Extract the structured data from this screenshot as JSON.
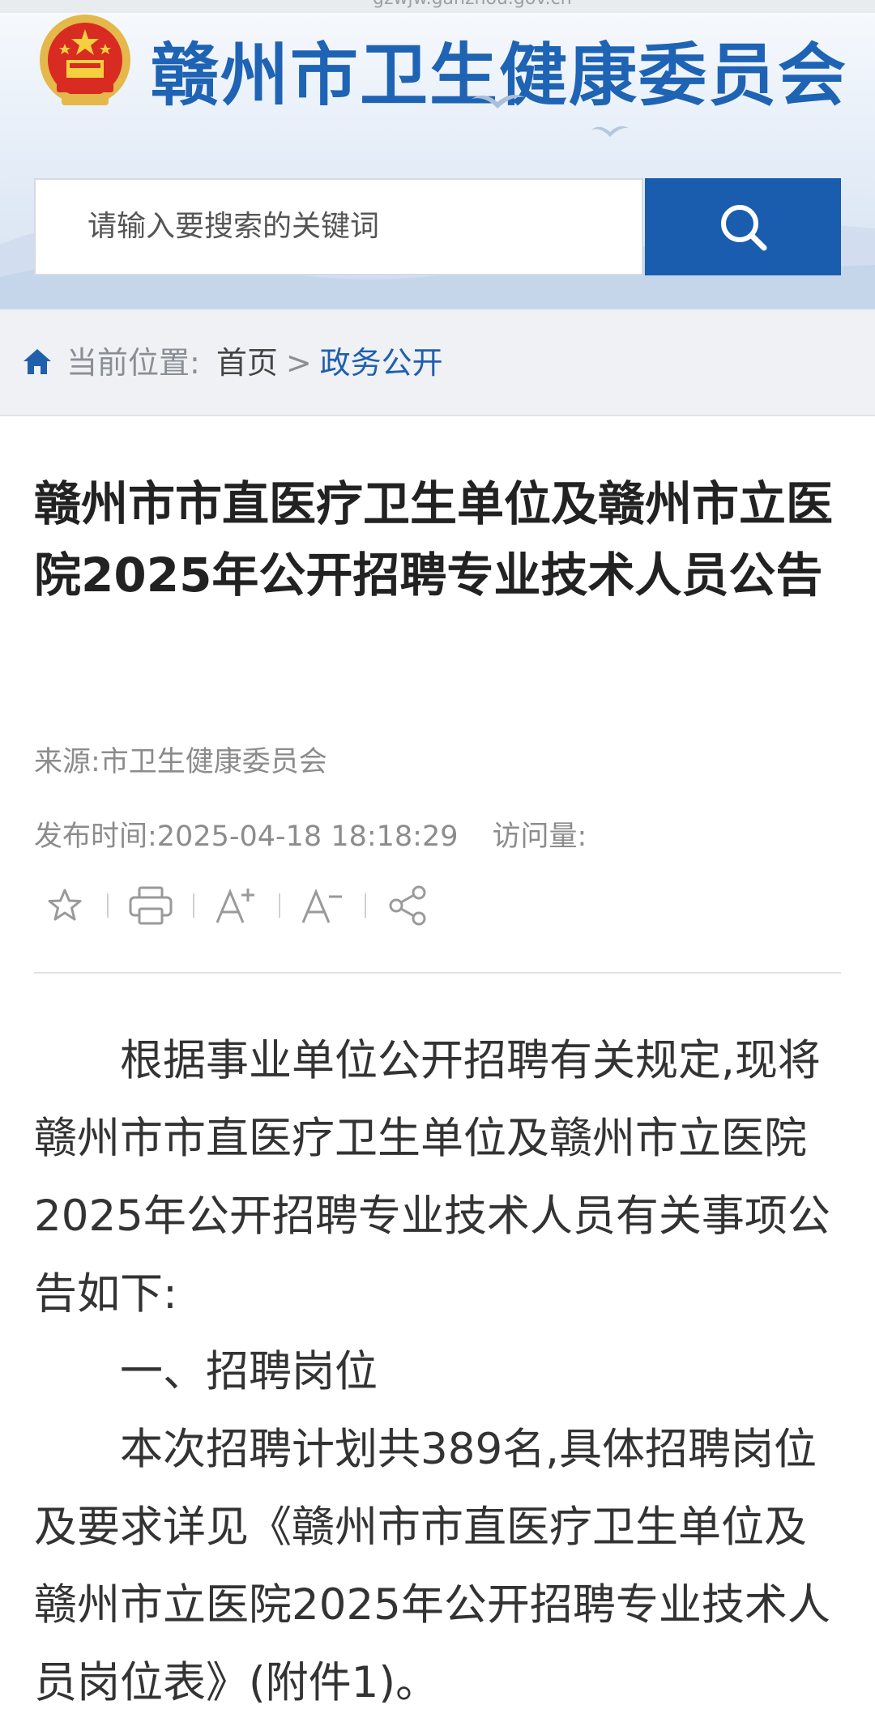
{
  "url_strip": "gzwjw.ganzhou.gov.cn",
  "header": {
    "site_title": "赣州市卫生健康委员会",
    "emblem_icon": "national-emblem-icon"
  },
  "search": {
    "placeholder": "请输入要搜索的关键词",
    "button_icon": "search-icon"
  },
  "breadcrumb": {
    "label": "当前位置:",
    "home": "首页",
    "separator": ">",
    "current": "政务公开"
  },
  "article": {
    "title": "赣州市市直医疗卫生单位及赣州市立医院2025年公开招聘专业技术人员公告",
    "source": "来源:市卫生健康委员会",
    "publish_time": "发布时间:2025-04-18 18:18:29",
    "visits": "访问量:",
    "paragraphs": [
      "根据事业单位公开招聘有关规定,现将赣州市市直医疗卫生单位及赣州市立医院2025年公开招聘专业技术人员有关事项公告如下:",
      "一、招聘岗位",
      "本次招聘计划共389名,具体招聘岗位及要求详见《赣州市市直医疗卫生单位及赣州市立医院2025年公开招聘专业技术人员岗位表》(附件1)。"
    ]
  },
  "toolbar": [
    "star-icon",
    "print-icon",
    "font-increase-icon",
    "font-decrease-icon",
    "share-icon"
  ],
  "colors": {
    "brand": "#1e63b4",
    "search_button": "#1a5cad",
    "breadcrumb_bg": "#eff1f4",
    "link": "#1f5fae"
  }
}
